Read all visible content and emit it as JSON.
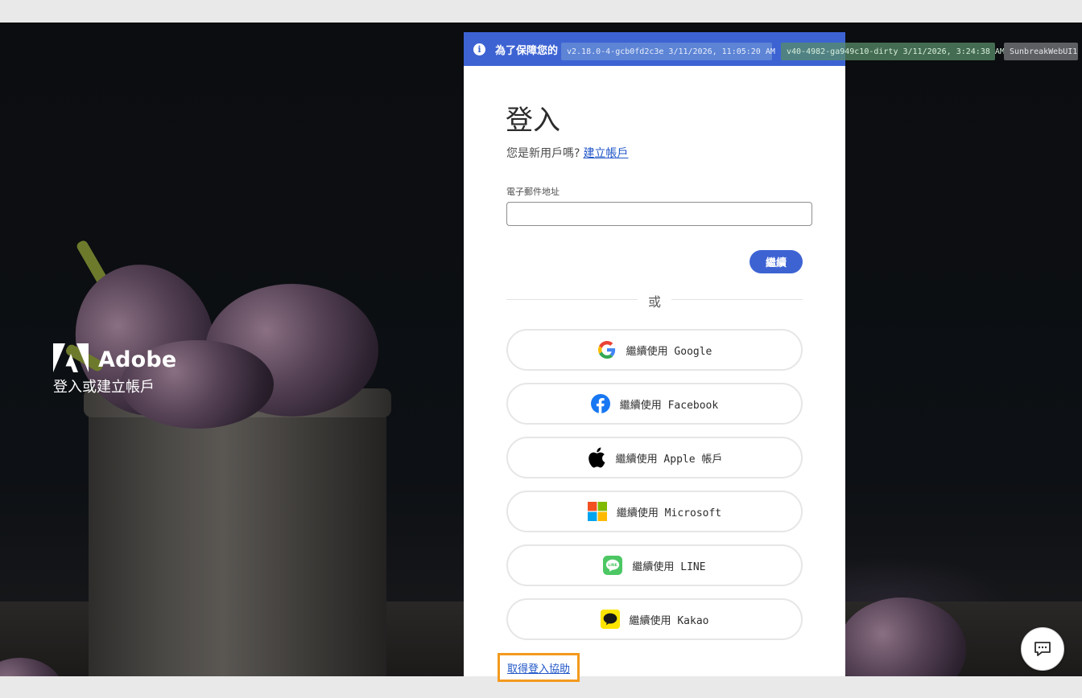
{
  "brand": {
    "name": "Adobe",
    "subtitle": "登入或建立帳戶"
  },
  "banner": {
    "text": "為了保障您的"
  },
  "version_tags": [
    "v2.18.0-4-gcb0fd2c3e 3/11/2026, 11:05:20 AM",
    "v40-4982-ga949c10-dirty 3/11/2026, 3:24:38 AM",
    "SunbreakWebUI1"
  ],
  "form": {
    "title": "登入",
    "new_user_prompt": "您是新用戶嗎?",
    "create_account_link": "建立帳戶",
    "email_label": "電子郵件地址",
    "email_value": "",
    "continue_label": "繼續",
    "or_label": "或"
  },
  "social": {
    "google": "繼續使用 Google",
    "facebook": "繼續使用 Facebook",
    "apple": "繼續使用 Apple 帳戶",
    "microsoft": "繼續使用 Microsoft",
    "line": "繼續使用 LINE",
    "kakao": "繼續使用 Kakao"
  },
  "help_link": "取得登入協助",
  "icons": {
    "info": "info-icon",
    "chat": "chat-icon"
  },
  "colors": {
    "accent": "#3d63d3",
    "help_highlight": "#f39a1e"
  }
}
